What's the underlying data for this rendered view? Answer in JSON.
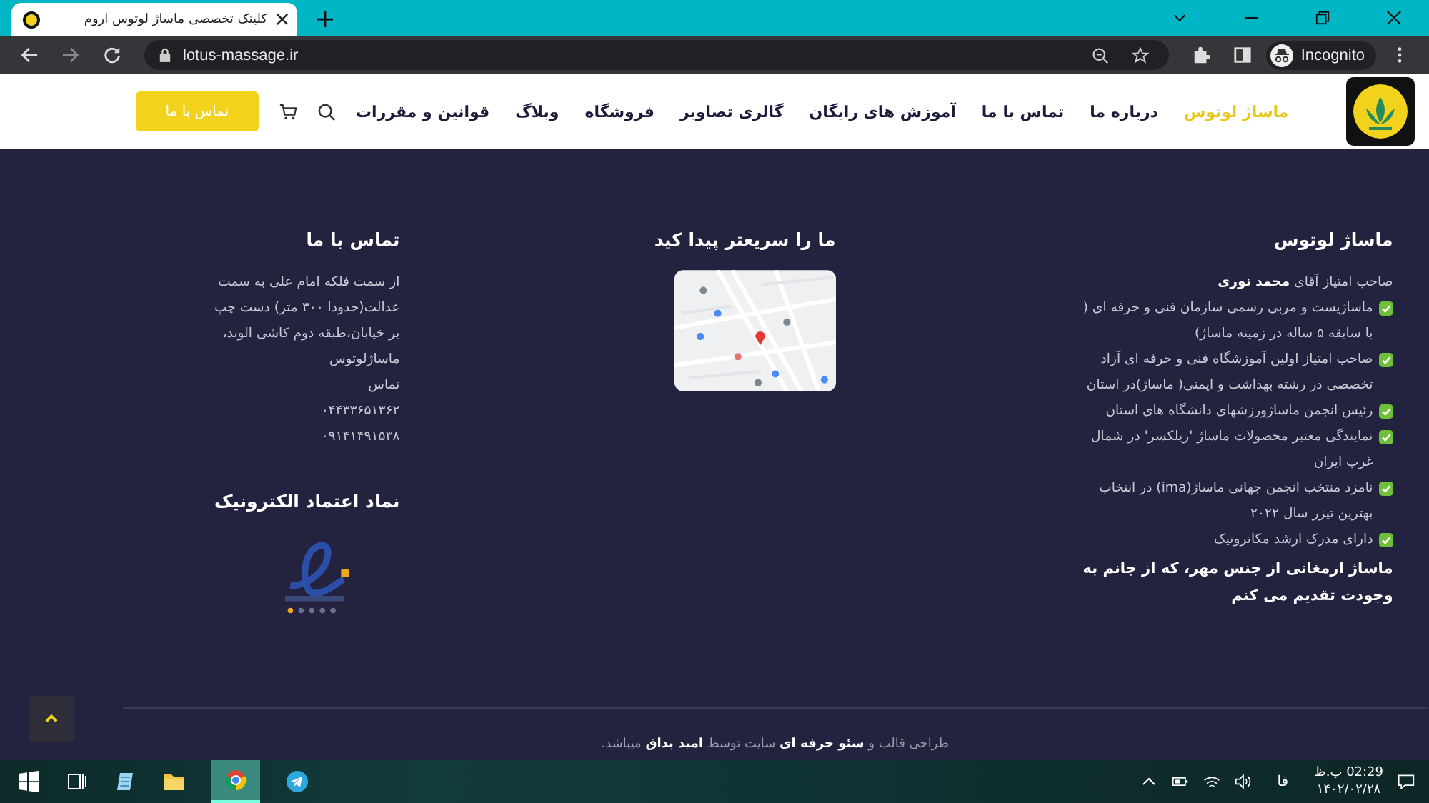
{
  "browser": {
    "tab_title": "کلینک تخصصی ماساژ لوتوس اروم",
    "url": "lotus-massage.ir",
    "profile": "Incognito"
  },
  "header": {
    "nav": [
      {
        "label": "ماساژ لوتوس",
        "selected": true
      },
      {
        "label": "درباره ما",
        "selected": false
      },
      {
        "label": "تماس با ما",
        "selected": false
      },
      {
        "label": "آموزش های رایگان",
        "selected": false
      },
      {
        "label": "گالری تصاویر",
        "selected": false
      },
      {
        "label": "فروشگاه",
        "selected": false
      },
      {
        "label": "وبلاگ",
        "selected": false
      },
      {
        "label": "قوانین و مقررات",
        "selected": false
      }
    ],
    "cta": "تماس با ما"
  },
  "about": {
    "title": "ماساژ لوتوس",
    "intro": "صاحب امتیاز آقای **محمد نوری**",
    "items": [
      "ماساژیست و مربی رسمی سازمان فنی و حرفه ای ( با سابقه ۵ ساله در زمینه ماساژ)",
      "صاحب امتیاز اولین آموزشگاه فنی و حرفه ای آزاد تخصصی در رشته بهداشت و ایمنی( ماساژ)در استان",
      "رئیس انجمن ماساژورزشهای دانشگاه های استان",
      "نمایندگی معتبر محصولات ماساژ 'ریلکسر' در شمال غرب ایران",
      "نامزد منتخب انجمن جهانی ماساژ(ima) در انتخاب بهترین تیزر سال ۲۰۲۲",
      "دارای مدرک ارشد مکاترونیک"
    ],
    "closing": "ماساژ ارمغانی از جنس مهر، که از جانم به وجودت تقدیم می کنم"
  },
  "map": {
    "title": "ما را سریعتر پیدا کید"
  },
  "contact": {
    "title": "تماس با ما",
    "address": "از سمت فلکه امام علی به سمت عدالت(حدودا ۳۰۰ متر) دست چپ بر خیابان،طبقه دوم کاشی الوند، ماساژلوتوس",
    "lines": [
      "تماس",
      "۰۴۴۳۳۶۵۱۳۶۲",
      "۰۹۱۴۱۴۹۱۵۳۸"
    ]
  },
  "trust": {
    "title": "نماد اعتماد الکترونیک"
  },
  "credit": "طراحی قالب و **سئو حرفه ای** سایت توسط **امید بداق** میباشد.",
  "taskbar": {
    "language": "فا",
    "time": "02:29 ب.ظ",
    "date": "۱۴۰۲/۰۲/۲۸"
  }
}
